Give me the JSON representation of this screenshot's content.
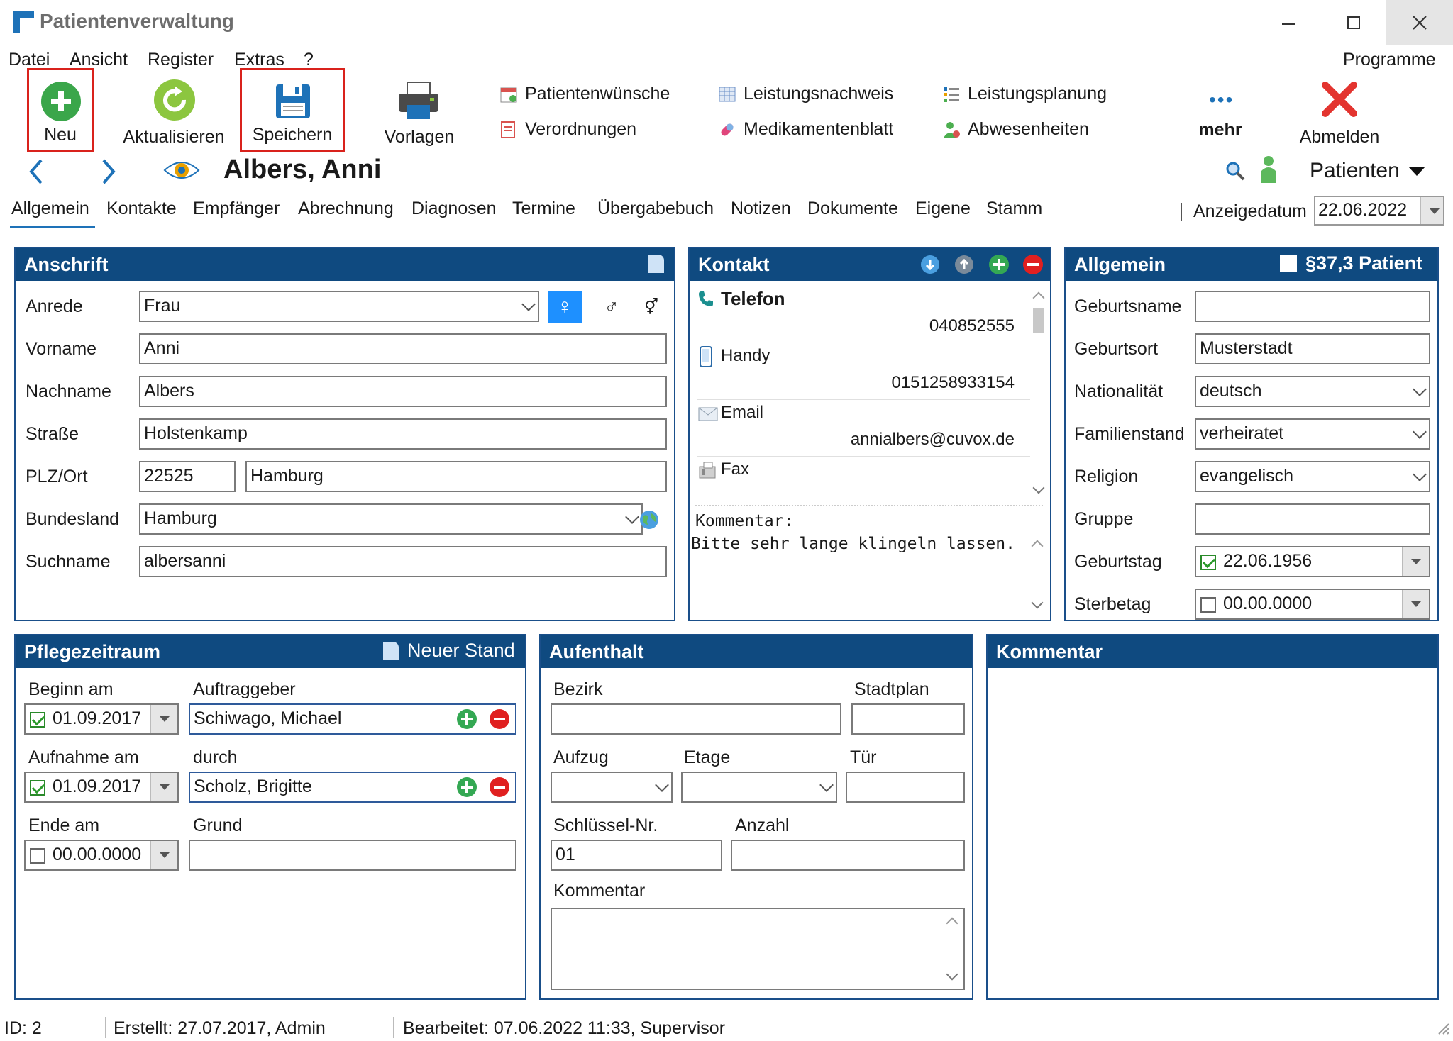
{
  "window": {
    "title": "Patientenverwaltung"
  },
  "menu": {
    "items": [
      "Datei",
      "Ansicht",
      "Register",
      "Extras",
      "?"
    ],
    "right": "Programme"
  },
  "ribbon": {
    "neu": "Neu",
    "aktualisieren": "Aktualisieren",
    "speichern": "Speichern",
    "vorlagen": "Vorlagen",
    "patientenwuensche": "Patientenwünsche",
    "verordnungen": "Verordnungen",
    "leistungsnachweis": "Leistungsnachweis",
    "medikamentenblatt": "Medikamentenblatt",
    "leistungsplanung": "Leistungsplanung",
    "abwesenheiten": "Abwesenheiten",
    "mehr": "mehr",
    "abmelden": "Abmelden"
  },
  "nav": {
    "patient_name": "Albers, Anni",
    "patienten": "Patienten"
  },
  "tabs": [
    "Allgemein",
    "Kontakte",
    "Empfänger",
    "Abrechnung",
    "Diagnosen",
    "Termine",
    "Übergabebuch",
    "Notizen",
    "Dokumente",
    "Eigene",
    "Stamm"
  ],
  "anzeigedatum": {
    "label": "Anzeigedatum",
    "value": "22.06.2022"
  },
  "anschrift": {
    "title": "Anschrift",
    "anrede_label": "Anrede",
    "anrede": "Frau",
    "vorname_label": "Vorname",
    "vorname": "Anni",
    "nachname_label": "Nachname",
    "nachname": "Albers",
    "strasse_label": "Straße",
    "strasse": "Holstenkamp",
    "plzort_label": "PLZ/Ort",
    "plz": "22525",
    "ort": "Hamburg",
    "bundesland_label": "Bundesland",
    "bundesland": "Hamburg",
    "suchname_label": "Suchname",
    "suchname": "albersanni"
  },
  "kontakt": {
    "title": "Kontakt",
    "telefon_label": "Telefon",
    "telefon": "040852555",
    "handy_label": "Handy",
    "handy": "0151258933154",
    "email_label": "Email",
    "email": "annialbers@cuvox.de",
    "fax_label": "Fax",
    "kommentar_label": "Kommentar:",
    "kommentar": "Bitte sehr lange klingeln lassen."
  },
  "allgemein": {
    "title": "Allgemein",
    "paragraph": "§37,3 Patient",
    "geburtsname_label": "Geburtsname",
    "geburtsname": "",
    "geburtsort_label": "Geburtsort",
    "geburtsort": "Musterstadt",
    "nationalitaet_label": "Nationalität",
    "nationalitaet": "deutsch",
    "familienstand_label": "Familienstand",
    "familienstand": "verheiratet",
    "religion_label": "Religion",
    "religion": "evangelisch",
    "gruppe_label": "Gruppe",
    "gruppe": "",
    "geburtstag_label": "Geburtstag",
    "geburtstag": "22.06.1956",
    "sterbetag_label": "Sterbetag",
    "sterbetag": "00.00.0000"
  },
  "pflegezeitraum": {
    "title": "Pflegezeitraum",
    "neuer_stand": "Neuer Stand",
    "beginn_label": "Beginn am",
    "beginn": "01.09.2017",
    "auftraggeber_label": "Auftraggeber",
    "auftraggeber": "Schiwago, Michael",
    "aufnahme_label": "Aufnahme am",
    "aufnahme": "01.09.2017",
    "durch_label": "durch",
    "durch": "Scholz, Brigitte",
    "ende_label": "Ende am",
    "ende": "00.00.0000",
    "grund_label": "Grund",
    "grund": ""
  },
  "aufenthalt": {
    "title": "Aufenthalt",
    "bezirk_label": "Bezirk",
    "bezirk": "",
    "stadtplan_label": "Stadtplan",
    "stadtplan": "",
    "aufzug_label": "Aufzug",
    "etage_label": "Etage",
    "tuer_label": "Tür",
    "schluessel_label": "Schlüssel-Nr.",
    "schluessel": "01",
    "anzahl_label": "Anzahl",
    "anzahl": "",
    "kommentar_label": "Kommentar"
  },
  "kommentar": {
    "title": "Kommentar"
  },
  "status": {
    "id": "ID: 2",
    "erstellt": "Erstellt: 27.07.2017, Admin",
    "bearbeitet": "Bearbeitet: 07.06.2022 11:33, Supervisor"
  },
  "colors": {
    "panel_header": "#0f4a80",
    "accent": "#1e72b8",
    "highlight_box": "#d9221c"
  }
}
